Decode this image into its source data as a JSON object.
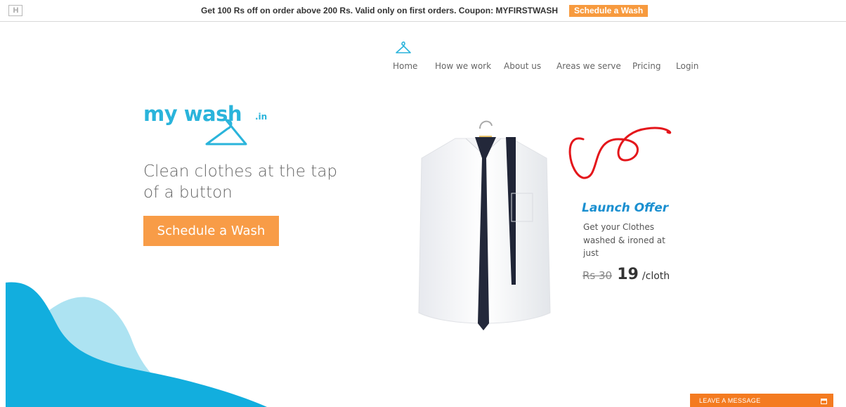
{
  "topbar": {
    "logo_mark": "H",
    "promo_text": "Get 100 Rs off on order above 200 Rs. Valid only on first orders. Coupon: MYFIRSTWASH",
    "promo_button": "Schedule a Wash"
  },
  "nav": {
    "items": [
      {
        "label": "Home"
      },
      {
        "label": "How we work"
      },
      {
        "label": "About us"
      },
      {
        "label": "Areas we serve"
      },
      {
        "label": "Pricing"
      },
      {
        "label": "Login"
      }
    ]
  },
  "hero": {
    "brand": "my wash",
    "brand_suffix": ".in",
    "tagline": "Clean clothes at the tap of a button",
    "button": "Schedule a Wash"
  },
  "offer": {
    "title": "Launch Offer",
    "text": "Get your Clothes washed & ironed at just",
    "old_price": "Rs 30",
    "new_price": "19",
    "unit": "/cloth"
  },
  "chat_widget": {
    "label": "LEAVE A MESSAGE"
  },
  "colors": {
    "accent_blue": "#2ab4db",
    "accent_orange": "#f89c47",
    "offer_blue": "#1a8fd0",
    "wave_dark": "#12aede",
    "wave_light": "#ade3f2",
    "ribbon_red": "#e4161b"
  },
  "icons": {
    "nav_logo": "hanger-icon",
    "brand_logo": "hanger-icon"
  }
}
